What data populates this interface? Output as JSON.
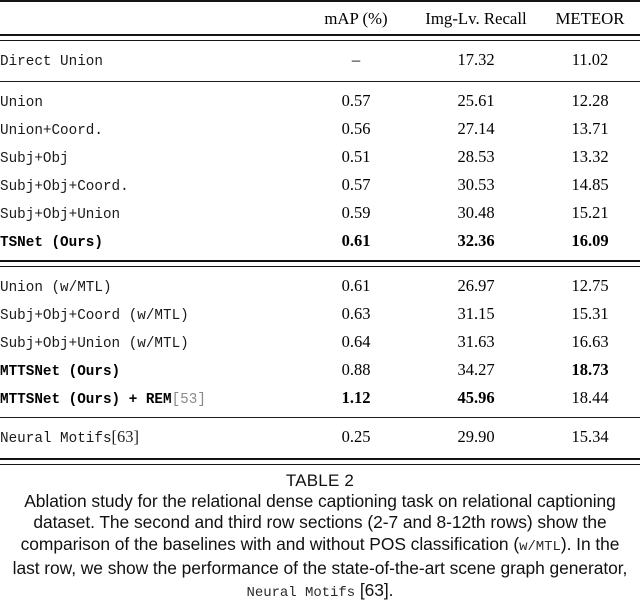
{
  "table": {
    "columns": [
      "",
      "mAP (%)",
      "Img-Lv. Recall",
      "METEOR"
    ],
    "sections": [
      {
        "rows": [
          {
            "label": "Direct Union",
            "bold": false,
            "map": "–",
            "map_bold": false,
            "recall": "17.32",
            "recall_bold": false,
            "meteor": "11.02",
            "meteor_bold": false
          }
        ]
      },
      {
        "rows": [
          {
            "label": "Union",
            "bold": false,
            "map": "0.57",
            "map_bold": false,
            "recall": "25.61",
            "recall_bold": false,
            "meteor": "12.28",
            "meteor_bold": false
          },
          {
            "label": "Union+Coord.",
            "bold": false,
            "map": "0.56",
            "map_bold": false,
            "recall": "27.14",
            "recall_bold": false,
            "meteor": "13.71",
            "meteor_bold": false
          },
          {
            "label": "Subj+Obj",
            "bold": false,
            "map": "0.51",
            "map_bold": false,
            "recall": "28.53",
            "recall_bold": false,
            "meteor": "13.32",
            "meteor_bold": false
          },
          {
            "label": "Subj+Obj+Coord.",
            "bold": false,
            "map": "0.57",
            "map_bold": false,
            "recall": "30.53",
            "recall_bold": false,
            "meteor": "14.85",
            "meteor_bold": false
          },
          {
            "label": "Subj+Obj+Union",
            "bold": false,
            "map": "0.59",
            "map_bold": false,
            "recall": "30.48",
            "recall_bold": false,
            "meteor": "15.21",
            "meteor_bold": false
          },
          {
            "label": "TSNet (Ours)",
            "bold": true,
            "map": "0.61",
            "map_bold": true,
            "recall": "32.36",
            "recall_bold": true,
            "meteor": "16.09",
            "meteor_bold": true
          }
        ]
      },
      {
        "rows": [
          {
            "label": "Union (w/MTL)",
            "bold": false,
            "map": "0.61",
            "map_bold": false,
            "recall": "26.97",
            "recall_bold": false,
            "meteor": "12.75",
            "meteor_bold": false
          },
          {
            "label": "Subj+Obj+Coord (w/MTL)",
            "bold": false,
            "map": "0.63",
            "map_bold": false,
            "recall": "31.15",
            "recall_bold": false,
            "meteor": "15.31",
            "meteor_bold": false
          },
          {
            "label": "Subj+Obj+Union (w/MTL)",
            "bold": false,
            "map": "0.64",
            "map_bold": false,
            "recall": "31.63",
            "recall_bold": false,
            "meteor": "16.63",
            "meteor_bold": false
          },
          {
            "label": "MTTSNet (Ours)",
            "bold": true,
            "map": "0.88",
            "map_bold": false,
            "recall": "34.27",
            "recall_bold": false,
            "meteor": "18.73",
            "meteor_bold": true
          },
          {
            "label": "MTTSNet (Ours) + REM",
            "ref": "[53]",
            "ref_style": "mono",
            "bold": true,
            "map": "1.12",
            "map_bold": true,
            "recall": "45.96",
            "recall_bold": true,
            "meteor": "18.44",
            "meteor_bold": false
          }
        ]
      },
      {
        "rows": [
          {
            "label": "Neural Motifs",
            "ref": "[63]",
            "ref_style": "serif",
            "bold": false,
            "map": "0.25",
            "map_bold": false,
            "recall": "29.90",
            "recall_bold": false,
            "meteor": "15.34",
            "meteor_bold": false
          }
        ]
      }
    ]
  },
  "caption": {
    "title": "TABLE 2",
    "line1": "Ablation study for the relational dense captioning task on relational",
    "line2_a": "captioning dataset. The second and third row sections (2-7 and 8-12th",
    "line3_a": "rows) show the comparison of the baselines with and without POS",
    "line4_a": "classification (",
    "line4_mono": "w/MTL",
    "line4_b": "). In the last row, we show the performance of the",
    "line5_a": "state-of-the-art scene graph generator, ",
    "line5_mono": "Neural Motifs",
    "line5_b": " [63]."
  }
}
